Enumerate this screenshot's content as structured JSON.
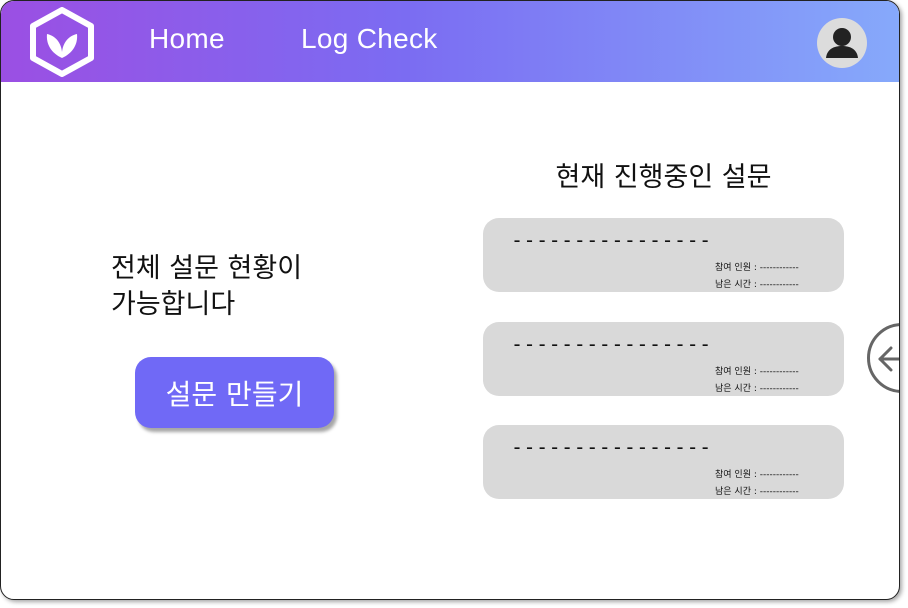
{
  "header": {
    "nav": [
      {
        "label": "Home"
      },
      {
        "label": "Log Check"
      }
    ]
  },
  "intro": {
    "line1": "전체 설문 현황이",
    "line2": "가능합니다"
  },
  "create_button": {
    "label": "설문 만들기"
  },
  "active_surveys": {
    "title": "현재 진행중인 설문",
    "items": [
      {
        "title": "----------------",
        "participants_label": "참여 인원 : ------------",
        "time_left_label": "남은 시간 : ------------"
      },
      {
        "title": "----------------",
        "participants_label": "참여 인원 : ------------",
        "time_left_label": "남은 시간 : ------------"
      },
      {
        "title": "----------------",
        "participants_label": "참여 인원 : ------------",
        "time_left_label": "남은 시간 : ------------"
      }
    ]
  },
  "icons": {
    "logo": "hexagon-leaf-logo",
    "avatar": "user-avatar-icon",
    "side_toggle": "arrow-left-icon"
  },
  "colors": {
    "header_gradient_start": "#9b4fe3",
    "header_gradient_end": "#86a9fb",
    "primary_button": "#7069f6",
    "card_background": "#d9d9d9"
  }
}
